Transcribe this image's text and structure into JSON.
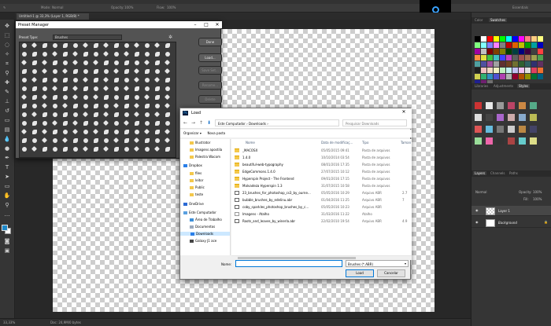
{
  "app": {
    "doc_tab": "Untitled-1 @ 33,3% (Layer 1, RGB/8) *",
    "options": [
      "Mode:",
      "Normal",
      "Opacity:",
      "100%",
      "Flow:",
      "100%"
    ],
    "workspace": "Essentials"
  },
  "status": {
    "zoom": "33,33%",
    "doc": "Doc: 24,9M/0 bytes"
  },
  "right_panels": {
    "top_tabs": [
      "Color",
      "Swatches"
    ],
    "mid_tabs": [
      "Libraries",
      "Adjustments",
      "Styles"
    ],
    "layer_tabs": [
      "Layers",
      "Channels",
      "Paths"
    ],
    "layer_mode": "Normal",
    "layer_opacity_label": "Opacity:",
    "layer_opacity": "100%",
    "layer_fill_label": "Fill:",
    "layer_fill": "100%",
    "layers": [
      "Layer 1",
      "Background"
    ],
    "swatch_colors": [
      "#000000",
      "#ffffff",
      "#ff0000",
      "#ffff00",
      "#00ff00",
      "#00ffff",
      "#0000ff",
      "#ff00ff",
      "#ff8080",
      "#ffcc80",
      "#ffff80",
      "#80ff80",
      "#80ffff",
      "#8080ff",
      "#ff80ff",
      "#808080",
      "#c00000",
      "#e06000",
      "#c0c000",
      "#00a000",
      "#00a0a0",
      "#0000c0",
      "#a000a0",
      "#c0c0c0",
      "#800000",
      "#804000",
      "#808000",
      "#004000",
      "#004040",
      "#000080",
      "#400040",
      "#404040",
      "#ff4040",
      "#ff9040",
      "#e0e040",
      "#40c040",
      "#40c0c0",
      "#4040ff",
      "#c040c0",
      "#606060",
      "#a05050",
      "#a07050",
      "#a0a050",
      "#50a050",
      "#50a0a0",
      "#5050a0",
      "#a050a0",
      "#a0a0a0",
      "#603030",
      "#704020",
      "#707030",
      "#306030",
      "#306060",
      "#303070",
      "#603060",
      "#202020",
      "#f0c0c0",
      "#f0d8c0",
      "#f0f0c0",
      "#c0f0c0",
      "#c0f0f0",
      "#c0c0f0",
      "#f0c0f0",
      "#e0e0e0",
      "#e04060",
      "#f07030",
      "#d0d050",
      "#30b070",
      "#3090c0",
      "#5050d0",
      "#b040b0",
      "#b0b0b0",
      "#900030",
      "#b05000",
      "#909000",
      "#007030",
      "#006080",
      "#202090",
      "#702070",
      "#707070"
    ]
  },
  "preset_manager": {
    "title": "Preset Manager",
    "type_label": "Preset Type:",
    "type_value": "Brushes",
    "buttons": [
      "Done",
      "Load...",
      "Save Set...",
      "Rename...",
      "Delete"
    ]
  },
  "load_dialog": {
    "title": "Load",
    "path": [
      "Este Computador",
      "Downloads"
    ],
    "search_placeholder": "Pesquisar Downloads",
    "organize": "Organizar",
    "new_folder": "Nova pasta",
    "nav": [
      {
        "label": "Illustrator",
        "icon": "folder"
      },
      {
        "label": "Imagens apostila",
        "icon": "folder"
      },
      {
        "label": "Palestra Wacom",
        "icon": "folder"
      },
      {
        "label": "Dropbox",
        "icon": "dropbox"
      },
      {
        "label": "files",
        "icon": "folder"
      },
      {
        "label": "leitor",
        "icon": "folder"
      },
      {
        "label": "Public",
        "icon": "folder"
      },
      {
        "label": "teste",
        "icon": "folder"
      },
      {
        "label": "OneDrive",
        "icon": "onedrive"
      },
      {
        "label": "Este Computador",
        "icon": "computer"
      },
      {
        "label": "Área de Trabalho",
        "icon": "desktop"
      },
      {
        "label": "Documentos",
        "icon": "docs"
      },
      {
        "label": "Downloads",
        "icon": "download"
      },
      {
        "label": "Galaxy J1 ace",
        "icon": "phone"
      }
    ],
    "columns": [
      "Nome",
      "Data de modificaç...",
      "Tipo",
      "Taman"
    ],
    "files": [
      {
        "name": "_MACOSX",
        "date": "05/05/2015 09:41",
        "type": "Pasta de arquivos",
        "size": "",
        "kind": "folder"
      },
      {
        "name": "1.4.0",
        "date": "10/10/2014 03:54",
        "type": "Pasta de arquivos",
        "size": "",
        "kind": "folder"
      },
      {
        "name": "beautiful-web-typography",
        "date": "08/01/2016 17:35",
        "type": "Pasta de arquivos",
        "size": "",
        "kind": "folder"
      },
      {
        "name": "EdgeCommons.1.4.0",
        "date": "27/07/2015 10:12",
        "type": "Pasta de arquivos",
        "size": "",
        "kind": "folder"
      },
      {
        "name": "Hyperspin Project - The Frontend",
        "date": "09/01/2016 17:15",
        "type": "Pasta de arquivos",
        "size": "",
        "kind": "folder"
      },
      {
        "name": "Malvadeza Hyperspin 1.3",
        "date": "31/07/2015 10:58",
        "type": "Pasta de arquivos",
        "size": "",
        "kind": "folder"
      },
      {
        "name": "23_brushes_for_photoshop_cs3_by_ourne...",
        "date": "05/05/2016 10:29",
        "type": "Arquivo ABR",
        "size": "2.7",
        "kind": "abr"
      },
      {
        "name": "bubble_brushes_by_edelinu.abr",
        "date": "01/04/2016 11:25",
        "type": "Arquivo ABR",
        "size": "7",
        "kind": "abr"
      },
      {
        "name": "coby_sparkles_photoshop_brushes_by_c...",
        "date": "05/05/2016 10:23",
        "type": "Arquivo ABR",
        "size": "",
        "kind": "abr"
      },
      {
        "name": "Imagens - Atalho",
        "date": "31/03/2016 11:22",
        "type": "Atalho",
        "size": "",
        "kind": "lnk"
      },
      {
        "name": "Roots_and_leaves_by_winerla.abr",
        "date": "22/02/2010 19:54",
        "type": "Arquivo ABR",
        "size": "4.9",
        "kind": "abr"
      }
    ],
    "name_label": "Nome:",
    "name_value": "",
    "filter": "Brushes (*.ABR)",
    "load_btn": "Load",
    "cancel_btn": "Cancelar"
  }
}
